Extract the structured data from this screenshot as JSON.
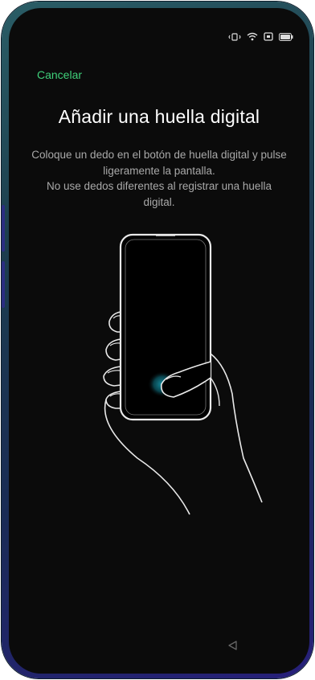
{
  "header": {
    "cancel_label": "Cancelar"
  },
  "main": {
    "title": "Añadir una huella digital",
    "instruction_1": "Coloque un dedo en el botón de huella digital y pulse ligeramente la pantalla.",
    "instruction_2": "No use dedos diferentes al registrar una huella digital."
  },
  "status_bar": {
    "icons": [
      "vibrate-icon",
      "wifi-icon",
      "sim-icon",
      "battery-icon"
    ]
  },
  "illustration": {
    "icon": "hand-holding-phone-fingerprint"
  },
  "nav_bar": {
    "icons": [
      "back-triangle-icon"
    ]
  },
  "colors": {
    "accent": "#3fd07a",
    "background": "#0b0b0b",
    "title_text": "#ffffff",
    "body_text": "#a9a9a9",
    "fingerprint_glow": "#1aa3b8"
  }
}
